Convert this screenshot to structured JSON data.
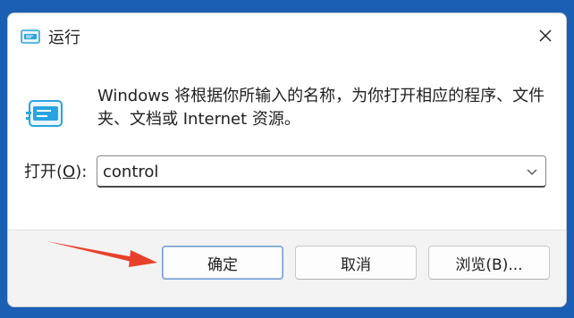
{
  "window": {
    "title": "运行",
    "icon": "run-app-icon",
    "close_icon": "close-icon"
  },
  "dialog": {
    "description": "Windows 将根据你所输入的名称，为你打开相应的程序、文件夹、文档或 Internet 资源。",
    "open_label_prefix": "打开(",
    "open_label_accel": "O",
    "open_label_suffix": "):",
    "open_value": "control"
  },
  "buttons": {
    "ok": "确定",
    "cancel": "取消",
    "browse": "浏览(B)..."
  },
  "colors": {
    "desktop": "#1a5fb4",
    "arrow": "#e8412b",
    "icon_blue": "#2aa4e0"
  }
}
